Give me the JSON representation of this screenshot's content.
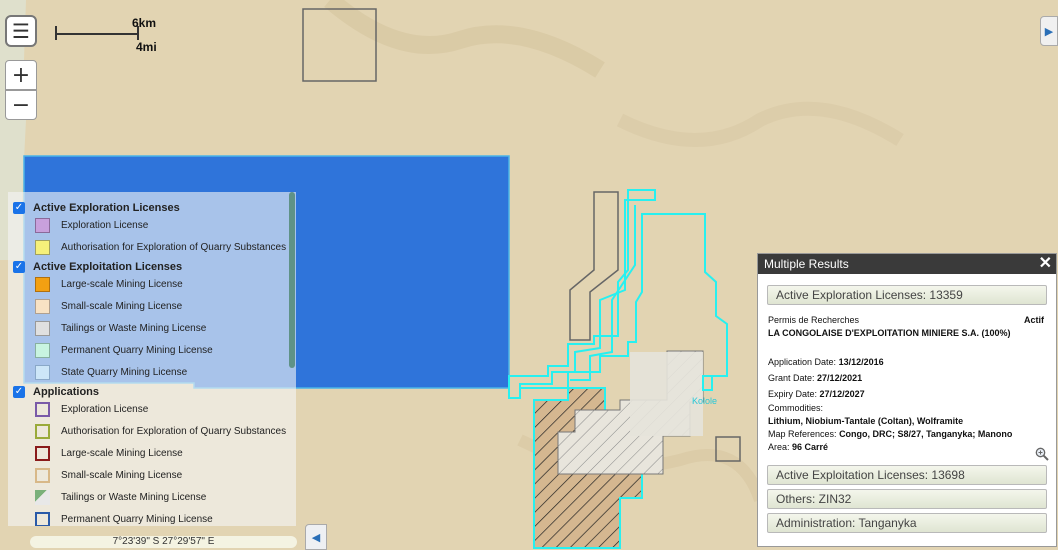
{
  "scale": {
    "km": "6km",
    "mi": "4mi"
  },
  "controls": {
    "menu_icon": "☰",
    "zoom_in": "+",
    "zoom_out": "−",
    "right_toggle": "▶",
    "legend_toggle": "◀"
  },
  "coordinates": "7°23'39\" S  27°29'57\" E",
  "map_labels": {
    "village": "Kolole"
  },
  "legend": {
    "groups": [
      {
        "label": "Active Exploration Licenses",
        "items": [
          {
            "label": "Exploration License",
            "fill": "#c8a0dc",
            "border": "#8a6a9a"
          },
          {
            "label": "Authorisation for Exploration of Quarry Substances",
            "fill": "#f5f07a",
            "border": "#a0a060"
          }
        ]
      },
      {
        "label": "Active Exploitation Licenses",
        "items": [
          {
            "label": "Large-scale Mining License",
            "fill": "#f3a012",
            "border": "#b07010"
          },
          {
            "label": "Small-scale Mining License",
            "fill": "#f8e2c4",
            "border": "#b0a090"
          },
          {
            "label": "Tailings or Waste Mining License",
            "fill": "#e0e0e0",
            "border": "#999999"
          },
          {
            "label": "Permanent Quarry Mining License",
            "fill": "#c8f4e0",
            "border": "#88b0a0"
          },
          {
            "label": "State Quarry Mining License",
            "fill": "#cde6f8",
            "border": "#8aa8c8"
          }
        ]
      },
      {
        "label": "Applications",
        "items": [
          {
            "label": "Exploration License",
            "fill": "transparent",
            "border": "#7a5aa8"
          },
          {
            "label": "Authorisation for Exploration of Quarry Substances",
            "fill": "transparent",
            "border": "#9aaa3a"
          },
          {
            "label": "Large-scale Mining License",
            "fill": "transparent",
            "border": "#8a1a1a"
          },
          {
            "label": "Small-scale Mining License",
            "fill": "transparent",
            "border": "#d8b888"
          },
          {
            "label": "Tailings or Waste Mining License",
            "fill": "image",
            "border": "#888888"
          },
          {
            "label": "Permanent Quarry Mining License",
            "fill": "transparent",
            "border": "#2a5aa8"
          }
        ]
      }
    ]
  },
  "popup": {
    "title": "Multiple Results",
    "close": "✕",
    "results": [
      "Active Exploration Licenses: 13359",
      "Active Exploitation Licenses: 13698",
      "Others: ZIN32",
      "Administration: Tanganyka"
    ],
    "detail": {
      "type": "Permis de Recherches",
      "status": "Actif",
      "holder": "LA CONGOLAISE D'EXPLOITATION MINIERE S.A. (100%)",
      "application_label": "Application Date:",
      "application_date": "13/12/2016",
      "grant_label": "Grant Date:",
      "grant_date": "27/12/2021",
      "expiry_label": "Expiry Date:",
      "expiry_date": "27/12/2027",
      "commodities_label": "Commodities:",
      "commodities": "Lithium, Niobium-Tantale (Coltan), Wolframite",
      "map_ref_label": "Map References:",
      "map_ref": "Congo, DRC;  S8/27, Tanganyka; Manono",
      "area_label": "Area:",
      "area": "96 Carré"
    }
  },
  "colors": {
    "basemap": "#e2d4b2",
    "blue_block": "#2f74da",
    "cyan": "#27f0f0",
    "highlight": "#e6e3da"
  }
}
